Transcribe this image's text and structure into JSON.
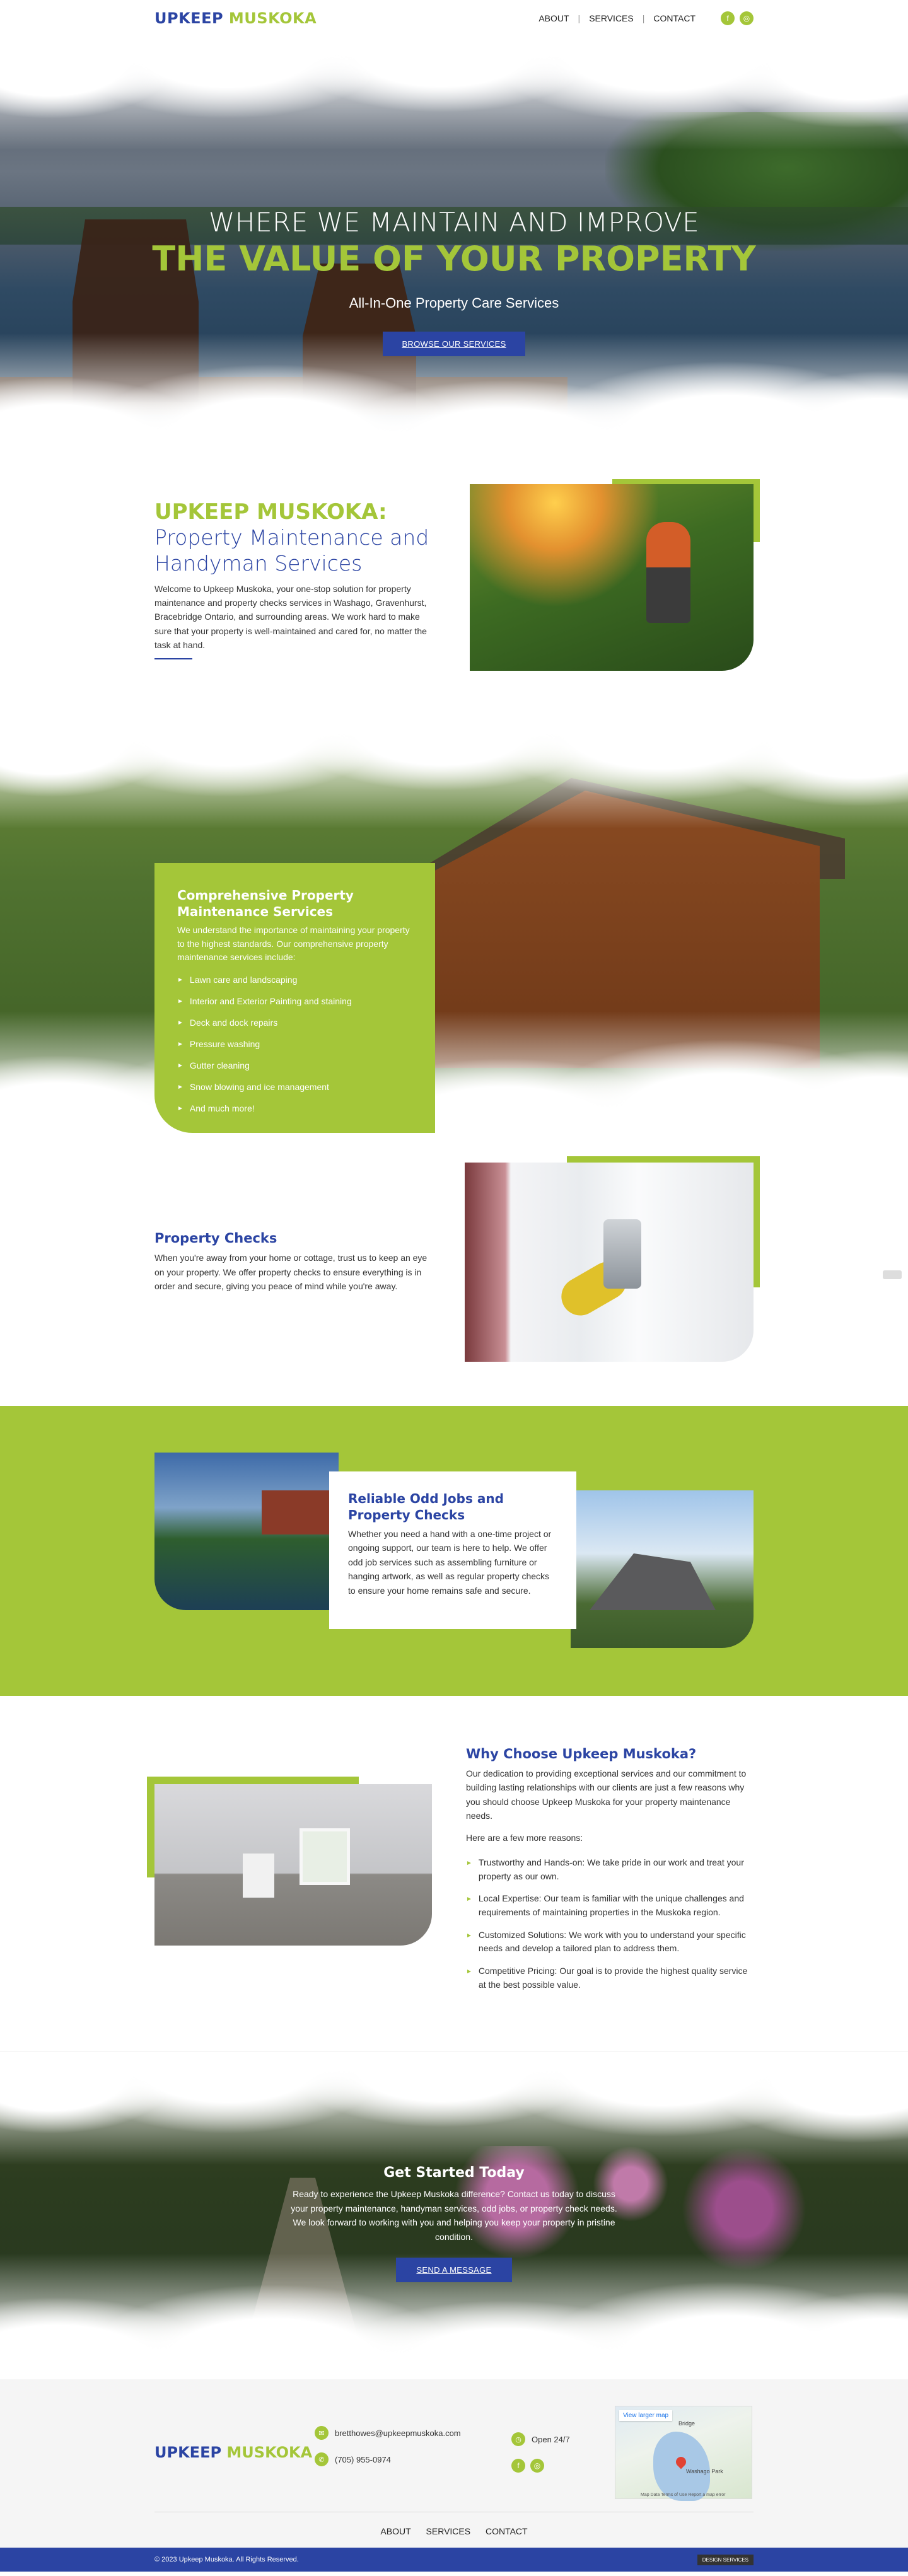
{
  "header": {
    "logo_part1": "UPKEEP",
    "logo_part2": "MUSKOKA",
    "nav": [
      "ABOUT",
      "SERVICES",
      "CONTACT"
    ],
    "social_icons": [
      "facebook-icon",
      "instagram-icon"
    ]
  },
  "hero": {
    "line1": "WHERE WE MAINTAIN AND IMPROVE",
    "line2": "THE VALUE OF YOUR PROPERTY",
    "subtitle": "All-In-One Property Care Services",
    "button": "BROWSE OUR SERVICES"
  },
  "about": {
    "title": "UPKEEP MUSKOKA:",
    "subtitle": "Property Maintenance and Handyman Services",
    "body": "Welcome to Upkeep Muskoka, your one-stop solution for property maintenance and property checks services in Washago, Gravenhurst, Bracebridge Ontario, and surrounding areas. We work hard to make sure that your property is well-maintained and cared for, no matter the task at hand."
  },
  "services": {
    "title": "Comprehensive Property Maintenance Services",
    "intro": "We understand the importance of maintaining your property to the highest standards. Our comprehensive property maintenance services include:",
    "items": [
      "Lawn care and landscaping",
      "Interior and Exterior Painting and staining",
      "Deck and dock repairs",
      "Pressure washing",
      "Gutter cleaning",
      "Snow blowing and ice management",
      "And much more!"
    ]
  },
  "checks": {
    "title": "Property Checks",
    "body": "When you're away from your home or cottage, trust us to keep an eye on your property. We offer property checks to ensure everything is in order and secure, giving you peace of mind while you're away."
  },
  "odd_jobs": {
    "title": "Reliable Odd Jobs and Property Checks",
    "body": "Whether you need a hand with a one-time project or ongoing support, our team is here to help. We offer odd job services such as assembling furniture or hanging artwork, as well as regular property checks to ensure your home remains safe and secure."
  },
  "why": {
    "title": "Why Choose Upkeep Muskoka?",
    "intro": "Our dedication to providing exceptional services and our commitment to building lasting relationships with our clients are just a few reasons why you should choose Upkeep Muskoka for your property maintenance needs.",
    "lead": "Here are a few more reasons:",
    "items": [
      "Trustworthy and Hands-on: We take pride in our work and treat your property as our own.",
      "Local Expertise: Our team is familiar with the unique challenges and requirements of maintaining properties in the Muskoka region.",
      "Customized Solutions: We work with you to understand your specific needs and develop a tailored plan to address them.",
      "Competitive Pricing: Our goal is to provide the highest quality service at the best possible value."
    ]
  },
  "cta": {
    "title": "Get Started Today",
    "body": "Ready to experience the Upkeep Muskoka difference? Contact us today to discuss your property maintenance, handyman services, odd jobs, or property check needs. We look forward to working with you and helping you keep your property in pristine condition.",
    "button": "SEND A MESSAGE"
  },
  "footer": {
    "logo_part1": "UPKEEP",
    "logo_part2": "MUSKOKA",
    "email": "bretthowes@upkeepmuskoka.com",
    "phone": "(705) 955-0974",
    "hours": "Open 24/7",
    "map": {
      "button": "View larger map",
      "label1": "Bridge",
      "label2": "Washago Park",
      "attribution": "Map Data  Terms of Use  Report a map error"
    },
    "nav": [
      "ABOUT",
      "SERVICES",
      "CONTACT"
    ],
    "copyright": "© 2023 Upkeep Muskoka. All Rights Reserved.",
    "badge": "DESIGN SERVICES"
  },
  "colors": {
    "brand_blue": "#2b44a3",
    "brand_green": "#a4c639"
  }
}
